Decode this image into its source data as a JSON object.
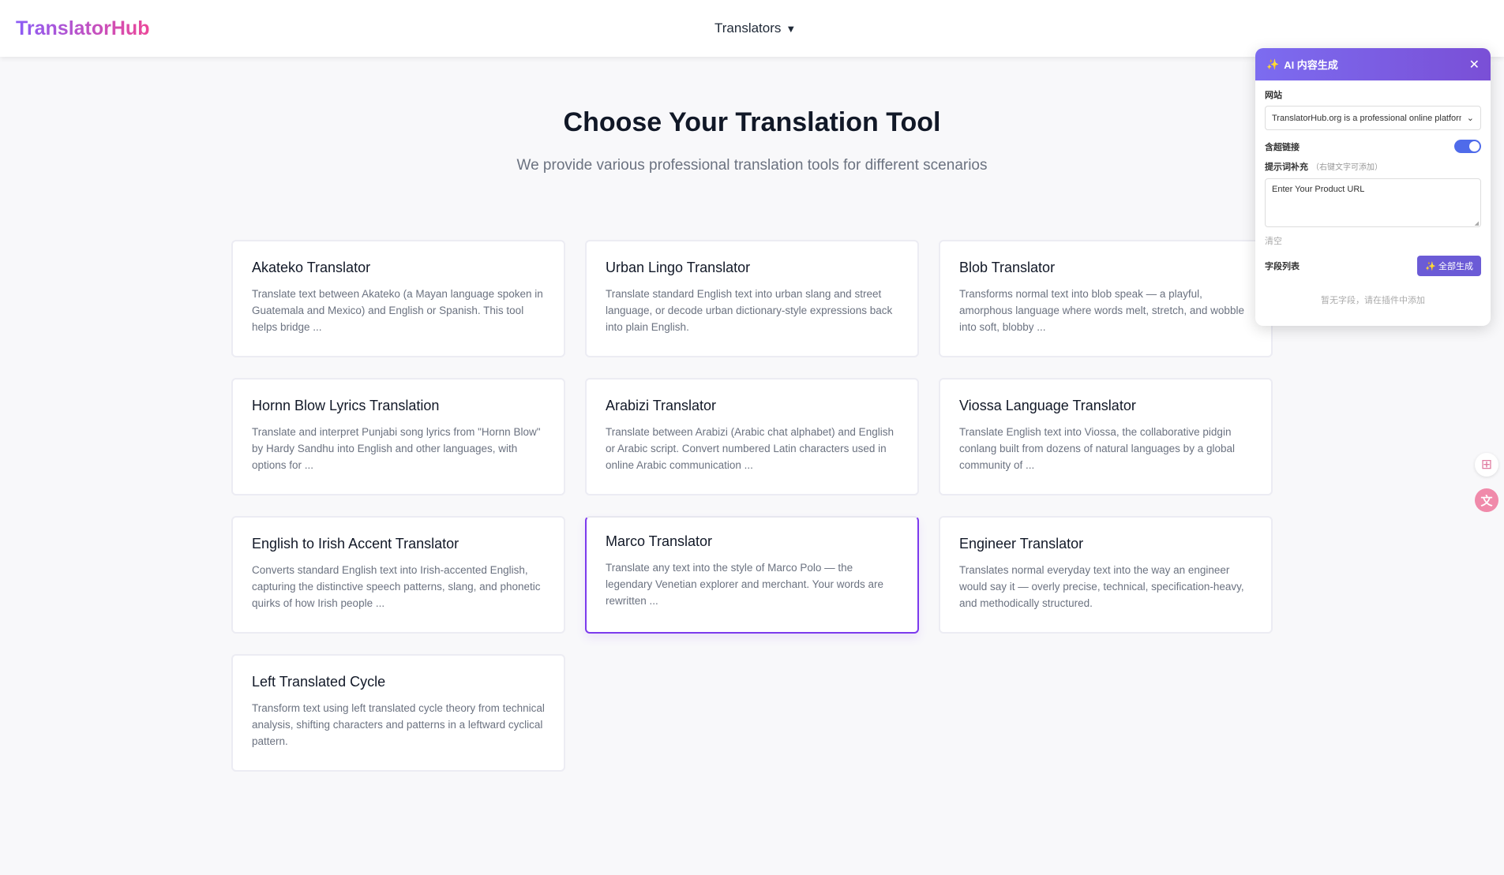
{
  "header": {
    "logo": "TranslatorHub",
    "nav_label": "Translators",
    "nav_caret": "▼"
  },
  "hero": {
    "title": "Choose Your Translation Tool",
    "subtitle": "We provide various professional translation tools for different scenarios"
  },
  "cards": [
    {
      "title": "Akateko Translator",
      "desc": "Translate text between Akateko (a Mayan language spoken in Guatemala and Mexico) and English or Spanish. This tool helps bridge ..."
    },
    {
      "title": "Urban Lingo Translator",
      "desc": "Translate standard English text into urban slang and street language, or decode urban dictionary-style expressions back into plain English."
    },
    {
      "title": "Blob Translator",
      "desc": "Transforms normal text into blob speak — a playful, amorphous language where words melt, stretch, and wobble into soft, blobby ..."
    },
    {
      "title": "Hornn Blow Lyrics Translation",
      "desc": "Translate and interpret Punjabi song lyrics from \"Hornn Blow\" by Hardy Sandhu into English and other languages, with options for ..."
    },
    {
      "title": "Arabizi Translator",
      "desc": "Translate between Arabizi (Arabic chat alphabet) and English or Arabic script. Convert numbered Latin characters used in online Arabic communication ..."
    },
    {
      "title": "Viossa Language Translator",
      "desc": "Translate English text into Viossa, the collaborative pidgin conlang built from dozens of natural languages by a global community of ..."
    },
    {
      "title": "English to Irish Accent Translator",
      "desc": "Converts standard English text into Irish-accented English, capturing the distinctive speech patterns, slang, and phonetic quirks of how Irish people ..."
    },
    {
      "title": "Marco Translator",
      "desc": "Translate any text into the style of Marco Polo — the legendary Venetian explorer and merchant. Your words are rewritten ..."
    },
    {
      "title": "Engineer Translator",
      "desc": "Translates normal everyday text into the way an engineer would say it — overly precise, technical, specification-heavy, and methodically structured."
    },
    {
      "title": "Left Translated Cycle",
      "desc": "Transform text using left translated cycle theory from technical analysis, shifting characters and patterns in a leftward cyclical pattern."
    }
  ],
  "ai_panel": {
    "title": "AI 内容生成",
    "close": "✕",
    "website_label": "网站",
    "website_value": "TranslatorHub.org is a professional online platform",
    "link_label": "含超链接",
    "prompt_label": "提示词补充",
    "prompt_hint": "（右键文字可添加）",
    "prompt_value": "Enter Your Product URL",
    "clear_label": "清空",
    "fields_label": "字段列表",
    "generate_label": "全部生成",
    "empty_text": "暂无字段，请在插件中添加"
  },
  "side_buttons": {
    "apps_icon": "⊞",
    "translate_icon": "文"
  },
  "colors": {
    "accent": "#7c3aed",
    "panel_header": "#7a5fe0",
    "toggle_on": "#4f6bea"
  }
}
